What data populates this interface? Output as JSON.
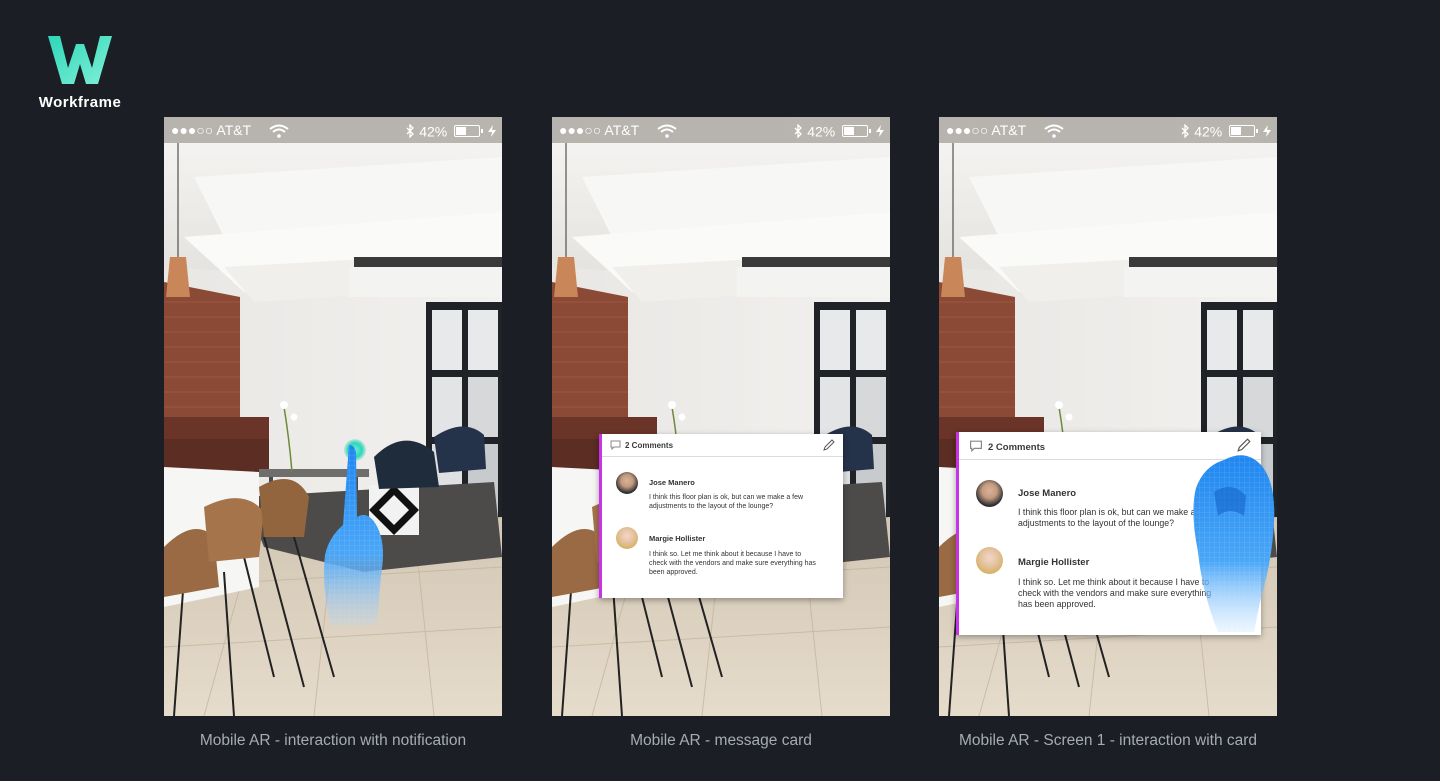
{
  "brand": {
    "name": "Workframe",
    "logo_letter": "W"
  },
  "status_bar": {
    "signal": "●●●○○",
    "carrier": "AT&T",
    "wifi_icon": "wifi-icon",
    "bluetooth_icon": "bluetooth-icon",
    "battery": "42%",
    "charging_icon": "bolt-icon"
  },
  "screens": [
    {
      "caption": "Mobile AR - interaction with notification"
    },
    {
      "caption": "Mobile AR - message card",
      "card": {
        "title": "2 Comments",
        "messages": [
          {
            "name": "Jose Manero",
            "text": "I think this floor plan is ok, but can we make a few adjustments to the layout of the lounge?"
          },
          {
            "name": "Margie Hollister",
            "text": "I think so. Let me think about it because I have to check with the vendors and make sure everything has been approved."
          }
        ]
      }
    },
    {
      "caption": "Mobile AR - Screen 1 - interaction with card",
      "card": {
        "title": "2 Comments",
        "messages": [
          {
            "name": "Jose Manero",
            "text": "I think this floor plan is ok, but can we make a few adjustments to the layout of the lounge?"
          },
          {
            "name": "Margie Hollister",
            "text": "I think so. Let me think about it because I have to check with the vendors and make sure everything has been approved."
          }
        ]
      }
    }
  ],
  "colors": {
    "background": "#1b1e24",
    "accent": "#c734e6",
    "logo": "#3fe0c3",
    "hand": "#2a8ff2",
    "caption": "#a7acb3"
  }
}
